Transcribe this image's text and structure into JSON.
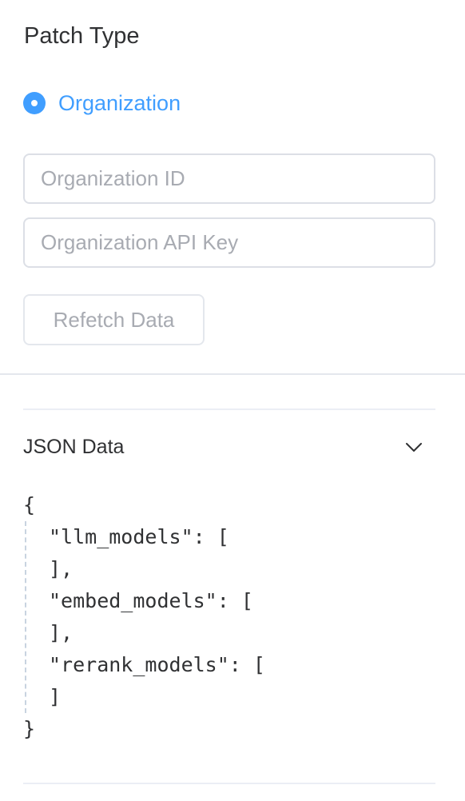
{
  "patch_type": {
    "title": "Patch Type",
    "option_label": "Organization",
    "selected": true
  },
  "inputs": {
    "org_id_placeholder": "Organization ID",
    "org_key_placeholder": "Organization API Key"
  },
  "actions": {
    "refetch_label": "Refetch Data"
  },
  "json_panel": {
    "title": "JSON Data",
    "open_brace": "{",
    "lines": [
      "\"llm_models\": [",
      "],",
      "\"embed_models\": [",
      "],",
      "\"rerank_models\": [",
      "]"
    ],
    "close_brace": "}"
  },
  "colors": {
    "accent": "#409eff",
    "border": "#dcdfe6",
    "placeholder": "#a8abb2",
    "text": "#303133"
  },
  "icons": {
    "radio": "radio-selected-icon",
    "collapse": "chevron-down-icon"
  }
}
